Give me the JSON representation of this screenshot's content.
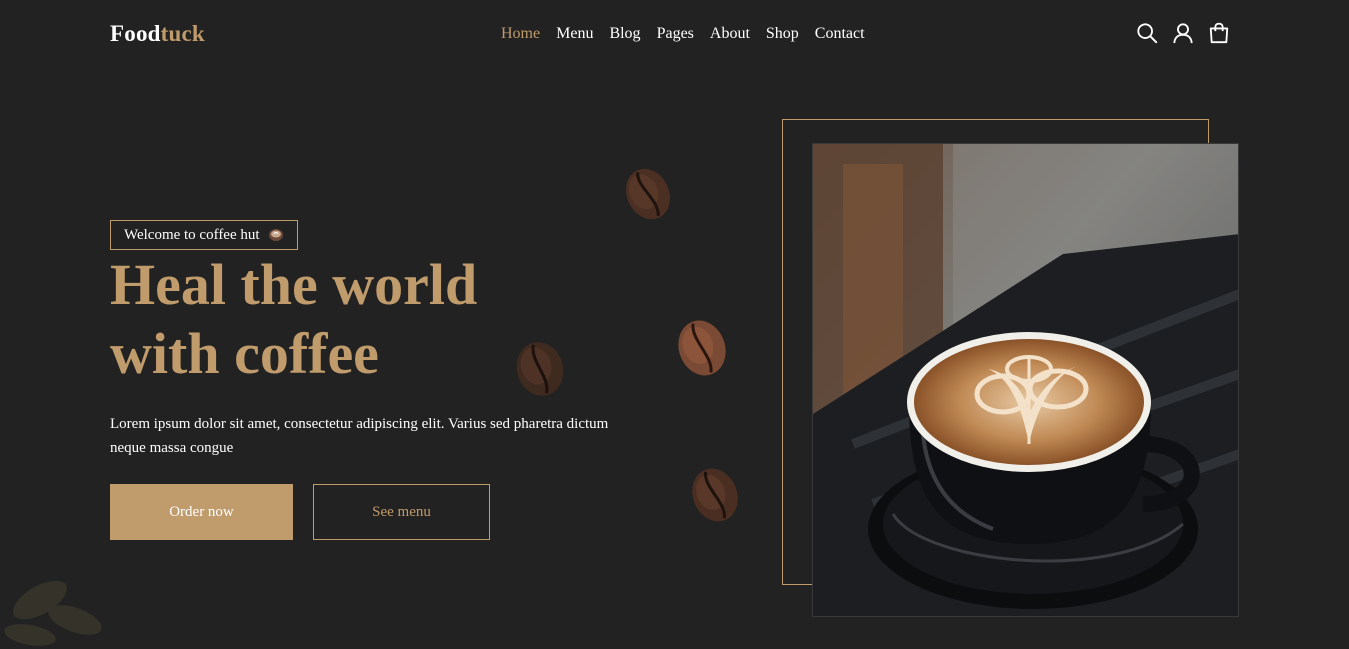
{
  "header": {
    "logo_main": "Food",
    "logo_accent": "tuck",
    "nav": [
      {
        "label": "Home",
        "active": true
      },
      {
        "label": "Menu",
        "active": false
      },
      {
        "label": "Blog",
        "active": false
      },
      {
        "label": "Pages",
        "active": false
      },
      {
        "label": "About",
        "active": false
      },
      {
        "label": "Shop",
        "active": false
      },
      {
        "label": "Contact",
        "active": false
      }
    ],
    "icons": [
      "search-icon",
      "user-icon",
      "shopping-bag-icon"
    ]
  },
  "hero": {
    "badge": "Welcome to coffee hut",
    "badge_icon": "coffee-cup-icon",
    "headline_line1": "Heal the world",
    "headline_line2": "with coffee",
    "description": "Lorem ipsum dolor sit amet, consectetur adipiscing elit. Varius sed pharetra dictum neque massa congue",
    "primary_button": "Order now",
    "secondary_button": "See menu"
  },
  "colors": {
    "background": "#222222",
    "accent": "#c09b6c",
    "text": "#ffffff"
  }
}
